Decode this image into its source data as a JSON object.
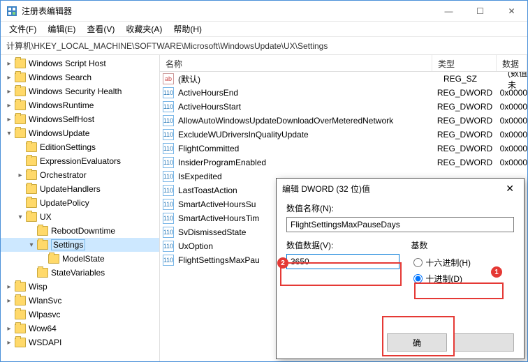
{
  "window": {
    "title": "注册表编辑器",
    "min_icon": "—",
    "max_icon": "☐",
    "close_icon": "✕"
  },
  "menu": {
    "file": "文件(F)",
    "edit": "编辑(E)",
    "view": "查看(V)",
    "favorites": "收藏夹(A)",
    "help": "帮助(H)"
  },
  "address": "计算机\\HKEY_LOCAL_MACHINE\\SOFTWARE\\Microsoft\\WindowsUpdate\\UX\\Settings",
  "tree": [
    {
      "d": 2,
      "e": ">",
      "l": "Windows Script Host"
    },
    {
      "d": 2,
      "e": ">",
      "l": "Windows Search"
    },
    {
      "d": 2,
      "e": ">",
      "l": "Windows Security Health"
    },
    {
      "d": 2,
      "e": ">",
      "l": "WindowsRuntime"
    },
    {
      "d": 2,
      "e": ">",
      "l": "WindowsSelfHost"
    },
    {
      "d": 2,
      "e": "v",
      "l": "WindowsUpdate"
    },
    {
      "d": 3,
      "e": "",
      "l": "EditionSettings"
    },
    {
      "d": 3,
      "e": "",
      "l": "ExpressionEvaluators"
    },
    {
      "d": 3,
      "e": ">",
      "l": "Orchestrator"
    },
    {
      "d": 3,
      "e": "",
      "l": "UpdateHandlers"
    },
    {
      "d": 3,
      "e": "",
      "l": "UpdatePolicy"
    },
    {
      "d": 3,
      "e": "v",
      "l": "UX"
    },
    {
      "d": 4,
      "e": "",
      "l": "RebootDowntime"
    },
    {
      "d": 4,
      "e": "v",
      "l": "Settings",
      "sel": true
    },
    {
      "d": 5,
      "e": "",
      "l": "ModelState"
    },
    {
      "d": 4,
      "e": "",
      "l": "StateVariables"
    },
    {
      "d": 2,
      "e": ">",
      "l": "Wisp"
    },
    {
      "d": 2,
      "e": ">",
      "l": "WlanSvc"
    },
    {
      "d": 2,
      "e": "",
      "l": "Wlpasvc"
    },
    {
      "d": 2,
      "e": ">",
      "l": "Wow64"
    },
    {
      "d": 2,
      "e": ">",
      "l": "WSDAPI"
    }
  ],
  "list": {
    "headers": {
      "name": "名称",
      "type": "类型",
      "data": "数据"
    },
    "rows": [
      {
        "icon": "sz",
        "name": "(默认)",
        "type": "REG_SZ",
        "data": "(数值未"
      },
      {
        "icon": "dw",
        "name": "ActiveHoursEnd",
        "type": "REG_DWORD",
        "data": "0x0000"
      },
      {
        "icon": "dw",
        "name": "ActiveHoursStart",
        "type": "REG_DWORD",
        "data": "0x0000"
      },
      {
        "icon": "dw",
        "name": "AllowAutoWindowsUpdateDownloadOverMeteredNetwork",
        "type": "REG_DWORD",
        "data": "0x0000"
      },
      {
        "icon": "dw",
        "name": "ExcludeWUDriversInQualityUpdate",
        "type": "REG_DWORD",
        "data": "0x0000"
      },
      {
        "icon": "dw",
        "name": "FlightCommitted",
        "type": "REG_DWORD",
        "data": "0x0000"
      },
      {
        "icon": "dw",
        "name": "InsiderProgramEnabled",
        "type": "REG_DWORD",
        "data": "0x0000"
      },
      {
        "icon": "dw",
        "name": "IsExpedited",
        "type": "",
        "data": ""
      },
      {
        "icon": "dw",
        "name": "LastToastAction",
        "type": "",
        "data": ""
      },
      {
        "icon": "dw",
        "name": "SmartActiveHoursSu",
        "type": "",
        "data": ""
      },
      {
        "icon": "dw",
        "name": "SmartActiveHoursTim",
        "type": "",
        "data": ""
      },
      {
        "icon": "dw",
        "name": "SvDismissedState",
        "type": "",
        "data": ""
      },
      {
        "icon": "dw",
        "name": "UxOption",
        "type": "",
        "data": ""
      },
      {
        "icon": "dw",
        "name": "FlightSettingsMaxPau",
        "type": "",
        "data": ""
      }
    ]
  },
  "dialog": {
    "title": "编辑 DWORD (32 位)值",
    "close_icon": "✕",
    "name_label": "数值名称(N):",
    "name_value": "FlightSettingsMaxPauseDays",
    "data_label": "数值数据(V):",
    "data_value": "3650",
    "base_label": "基数",
    "hex_label": "十六进制(H)",
    "dec_label": "十进制(D)",
    "ok_label": "确",
    "cancel_label": ""
  },
  "annotations": {
    "badge1": "1",
    "badge2": "2"
  }
}
